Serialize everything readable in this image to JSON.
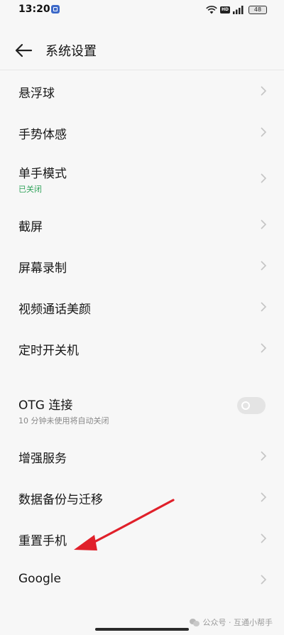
{
  "status_bar": {
    "time": "13:20",
    "hd": "HD",
    "battery": "48"
  },
  "header": {
    "title": "系统设置"
  },
  "items": [
    {
      "label": "悬浮球"
    },
    {
      "label": "手势体感"
    },
    {
      "label": "单手模式",
      "sub": "已关闭"
    },
    {
      "label": "截屏"
    },
    {
      "label": "屏幕录制"
    },
    {
      "label": "视频通话美颜"
    },
    {
      "label": "定时开关机"
    }
  ],
  "otg": {
    "label": "OTG 连接",
    "sub": "10 分钟未使用将自动关闭",
    "enabled": false
  },
  "items2": [
    {
      "label": "增强服务"
    },
    {
      "label": "数据备份与迁移"
    },
    {
      "label": "重置手机"
    },
    {
      "label": "Google"
    }
  ],
  "watermark": {
    "text": "公众号 · 互通小帮手"
  },
  "colors": {
    "accent_green": "#2fa35a",
    "arrow_red": "#e0202a",
    "background": "#f7f7f7"
  },
  "icons": {
    "back": "arrow-left-icon",
    "chevron": "chevron-right-icon",
    "wifi": "wifi-icon",
    "signal": "signal-icon"
  }
}
